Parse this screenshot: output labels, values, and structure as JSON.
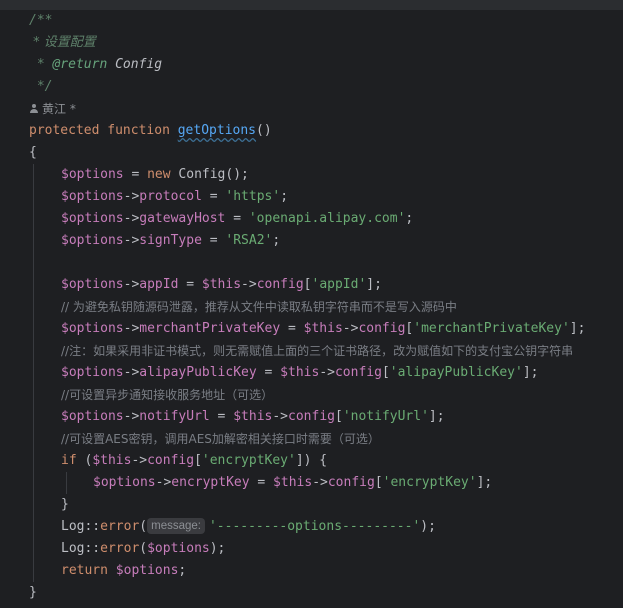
{
  "editor": {
    "language": "PHP",
    "doc_comment": {
      "open": "/**",
      "summary": " * 设置配置",
      "return_tag": "@return",
      "return_type": " Config",
      "close": " */"
    },
    "author_hint": "黄江 *",
    "signature": {
      "modifier": "protected",
      "keyword": "function",
      "name": "getOptions",
      "params": "()"
    },
    "lines": {
      "open_brace": "{",
      "l1_var": "$options",
      "l1_op": " = ",
      "l1_new": "new",
      "l1_rest": " Config();",
      "l2_var": "$options",
      "l2_arrow": "->",
      "l2_prop": "protocol",
      "l2_op": " = ",
      "l2_str": "'https'",
      "l2_end": ";",
      "l3_var": "$options",
      "l3_arrow": "->",
      "l3_prop": "gatewayHost",
      "l3_op": " = ",
      "l3_str": "'openapi.alipay.com'",
      "l3_end": ";",
      "l4_var": "$options",
      "l4_arrow": "->",
      "l4_prop": "signType",
      "l4_op": " = ",
      "l4_str": "'RSA2'",
      "l4_end": ";",
      "l5_var": "$options",
      "l5_arrow": "->",
      "l5_prop": "appId",
      "l5_op": " = ",
      "l5_this": "$this",
      "l5_arrow2": "->",
      "l5_cfg": "config",
      "l5_br": "[",
      "l5_str": "'appId'",
      "l5_end": "];",
      "c1": "// 为避免私钥随源码泄露，推荐从文件中读取私钥字符串而不是写入源码中",
      "l6_var": "$options",
      "l6_arrow": "->",
      "l6_prop": "merchantPrivateKey",
      "l6_op": " = ",
      "l6_this": "$this",
      "l6_arrow2": "->",
      "l6_cfg": "config",
      "l6_br": "[",
      "l6_str": "'merchantPrivateKey'",
      "l6_end": "];",
      "c2": "//注：如果采用非证书模式，则无需赋值上面的三个证书路径，改为赋值如下的支付宝公钥字符串",
      "l7_var": "$options",
      "l7_arrow": "->",
      "l7_prop": "alipayPublicKey",
      "l7_op": " = ",
      "l7_this": "$this",
      "l7_arrow2": "->",
      "l7_cfg": "config",
      "l7_br": "[",
      "l7_str": "'alipayPublicKey'",
      "l7_end": "];",
      "c3": "//可设置异步通知接收服务地址（可选）",
      "l8_var": "$options",
      "l8_arrow": "->",
      "l8_prop": "notifyUrl",
      "l8_op": " = ",
      "l8_this": "$this",
      "l8_arrow2": "->",
      "l8_cfg": "config",
      "l8_br": "[",
      "l8_str": "'notifyUrl'",
      "l8_end": "];",
      "c4": "//可设置AES密钥，调用AES加解密相关接口时需要（可选）",
      "if_kw": "if",
      "if_open": " (",
      "if_this": "$this",
      "if_arrow": "->",
      "if_cfg": "config",
      "if_br": "[",
      "if_str": "'encryptKey'",
      "if_close": "]) {",
      "l9_var": "$options",
      "l9_arrow": "->",
      "l9_prop": "encryptKey",
      "l9_op": " = ",
      "l9_this": "$this",
      "l9_arrow2": "->",
      "l9_cfg": "config",
      "l9_br": "[",
      "l9_str": "'encryptKey'",
      "l9_end": "];",
      "if_end": "}",
      "log1_cls": "Log",
      "log1_sep": "::",
      "log1_meth": "error",
      "log1_paren": "(",
      "log1_hint": "message:",
      "log1_str": "'---------options---------'",
      "log1_end": ");",
      "log2_cls": "Log",
      "log2_sep": "::",
      "log2_meth": "error",
      "log2_paren": "(",
      "log2_var": "$options",
      "log2_end": ");",
      "ret_kw": "return",
      "ret_var": " $options",
      "ret_end": ";",
      "close_brace": "}"
    }
  }
}
